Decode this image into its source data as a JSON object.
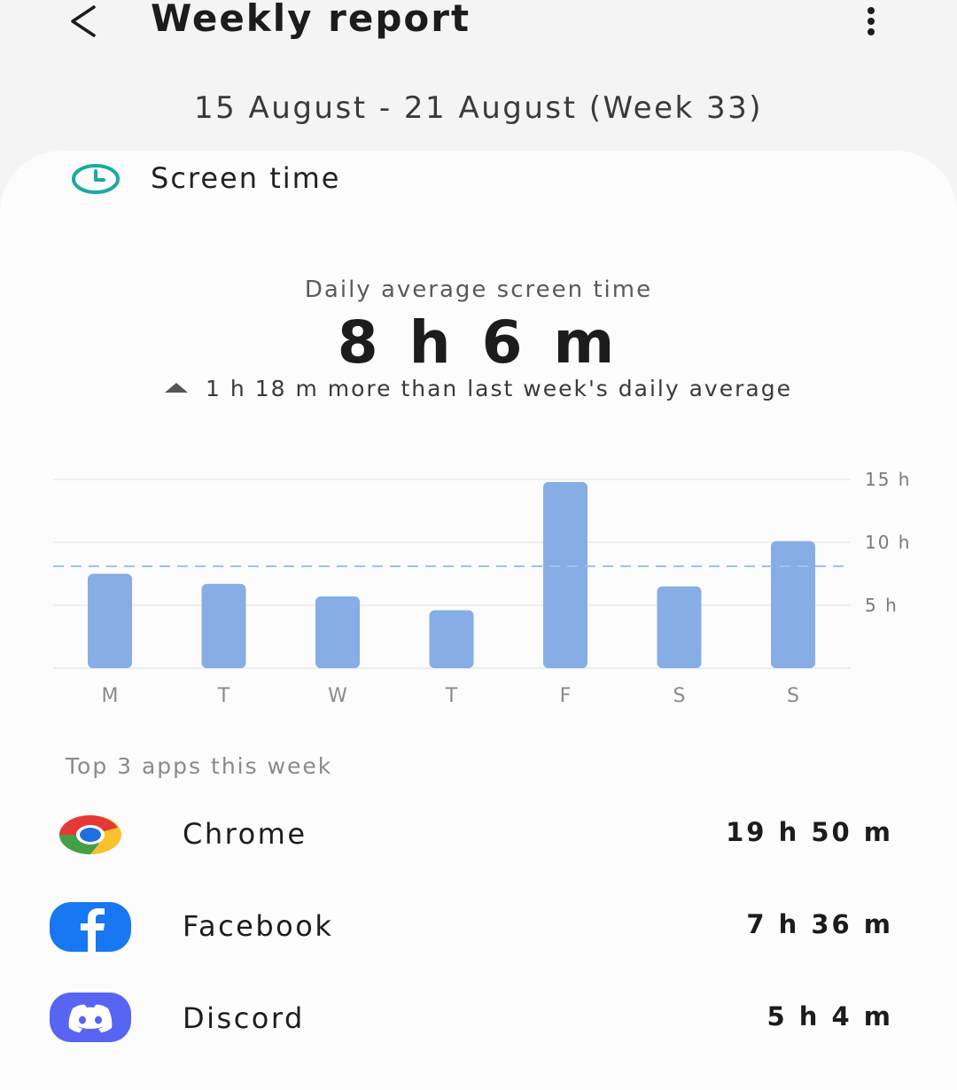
{
  "header": {
    "title": "Weekly report",
    "back_icon": "back-arrow-icon",
    "more_icon": "more-vertical-icon"
  },
  "date_range": "15 August - 21 August (Week 33)",
  "screen_time": {
    "section_title": "Screen time",
    "section_icon": "clock-icon",
    "avg_label": "Daily average screen time",
    "avg_value": "8 h 6 m",
    "delta_text": "1 h 18 m more than last week's daily average",
    "delta_icon": "triangle-up-icon"
  },
  "chart_data": {
    "type": "bar",
    "categories": [
      "M",
      "T",
      "W",
      "T",
      "F",
      "S",
      "S"
    ],
    "values": [
      7.5,
      6.7,
      5.7,
      4.6,
      14.8,
      6.5,
      10.1
    ],
    "y_ticks": [
      {
        "value": 5,
        "label": "5 h"
      },
      {
        "value": 10,
        "label": "10 h"
      },
      {
        "value": 15,
        "label": "15 h"
      }
    ],
    "ylim": [
      0,
      15
    ],
    "average_line": 8.1,
    "grid": true,
    "bar_color": "#86ade6",
    "avg_line_color": "#9dc2ee"
  },
  "top_apps": {
    "label": "Top 3 apps this week",
    "apps": [
      {
        "name": "Chrome",
        "time": "19 h 50 m",
        "icon": "chrome-icon"
      },
      {
        "name": "Facebook",
        "time": "7 h 36 m",
        "icon": "facebook-icon"
      },
      {
        "name": "Discord",
        "time": "5 h 4 m",
        "icon": "discord-icon"
      }
    ]
  }
}
